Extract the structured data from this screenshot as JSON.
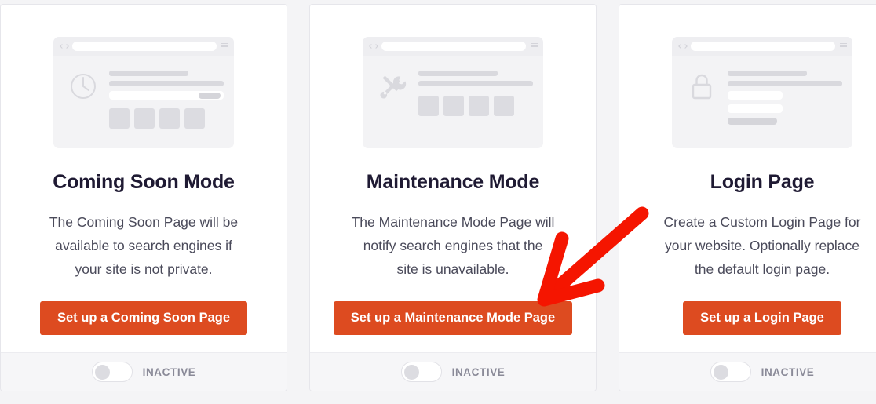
{
  "page": {
    "background_color": "#f4f4f6",
    "accent_color": "#dd4b20",
    "title_color": "#1f1a33"
  },
  "cards": [
    {
      "id": "coming-soon",
      "icon": "clock-icon",
      "title": "Coming Soon Mode",
      "description": "The Coming Soon Page will be\navailable to search engines if\nyour site is not private.",
      "button_label": "Set up a Coming Soon Page",
      "toggle_state": "off",
      "status_label": "INACTIVE"
    },
    {
      "id": "maintenance-mode",
      "icon": "tools-icon",
      "title": "Maintenance Mode",
      "description": "The Maintenance Mode Page will\nnotify search engines that the\nsite is unavailable.",
      "button_label": "Set up a Maintenance Mode Page",
      "toggle_state": "off",
      "status_label": "INACTIVE"
    },
    {
      "id": "login-page",
      "icon": "lock-icon",
      "title": "Login Page",
      "description": "Create a Custom Login Page for\nyour website. Optionally replace\nthe default login page.",
      "button_label": "Set up a Login Page",
      "toggle_state": "off",
      "status_label": "INACTIVE"
    }
  ],
  "annotation": {
    "type": "arrow",
    "color": "#f51500",
    "points_to": "Set up a Maintenance Mode Page"
  }
}
